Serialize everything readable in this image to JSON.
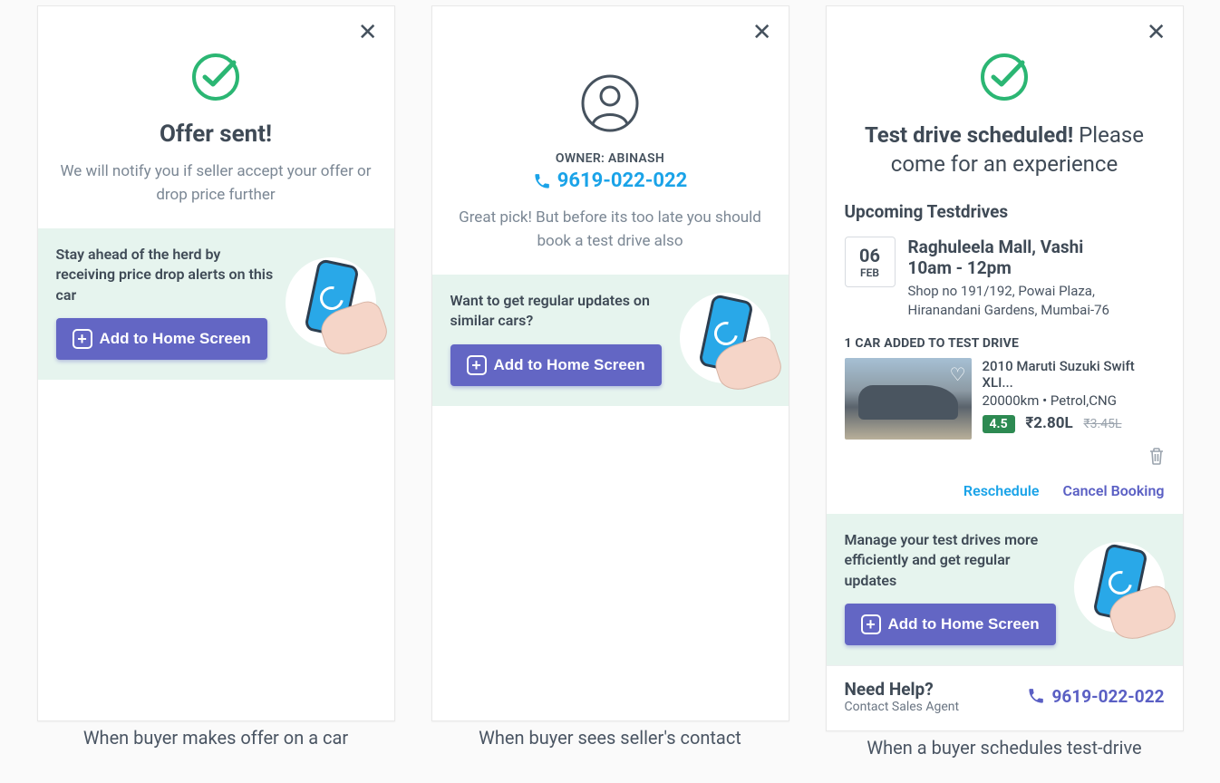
{
  "screens": {
    "offer": {
      "title": "Offer sent!",
      "subtitle": "We will notify you if seller accept your offer or drop price further",
      "promo_text": "Stay ahead of the herd by receiving price drop alerts on this car",
      "cta": "Add to Home Screen",
      "caption": "When buyer makes offer on a car"
    },
    "contact": {
      "owner_label": "OWNER: ABINASH",
      "phone": "9619-022-022",
      "subtitle": "Great pick! But before its too late you should book a test drive also",
      "promo_text": "Want to get regular updates on similar cars?",
      "cta": "Add to Home Screen",
      "caption": "When buyer sees seller's contact"
    },
    "testdrive": {
      "title_bold": "Test drive scheduled!",
      "title_rest": " Please come for an experience",
      "section_title": "Upcoming Testdrives",
      "date_day": "06",
      "date_mon": "FEB",
      "location": "Raghuleela Mall, Vashi",
      "timeslot": "10am - 12pm",
      "address": "Shop no 191/192, Powai Plaza, Hiranandani Gardens, Mumbai-76",
      "count_label": "1 CAR ADDED TO TEST DRIVE",
      "car": {
        "title": "2010 Maruti Suzuki Swift XLI...",
        "meta": "20000km • Petrol,CNG",
        "rating": "4.5",
        "price": "₹2.80L",
        "old_price": "₹3.45L"
      },
      "reschedule": "Reschedule",
      "cancel": "Cancel Booking",
      "promo_text": "Manage your test drives more efficiently and get regular updates",
      "cta": "Add to Home Screen",
      "help_title": "Need Help?",
      "help_sub": "Contact Sales Agent",
      "help_phone": "9619-022-022",
      "caption": "When a buyer schedules test-drive"
    }
  }
}
